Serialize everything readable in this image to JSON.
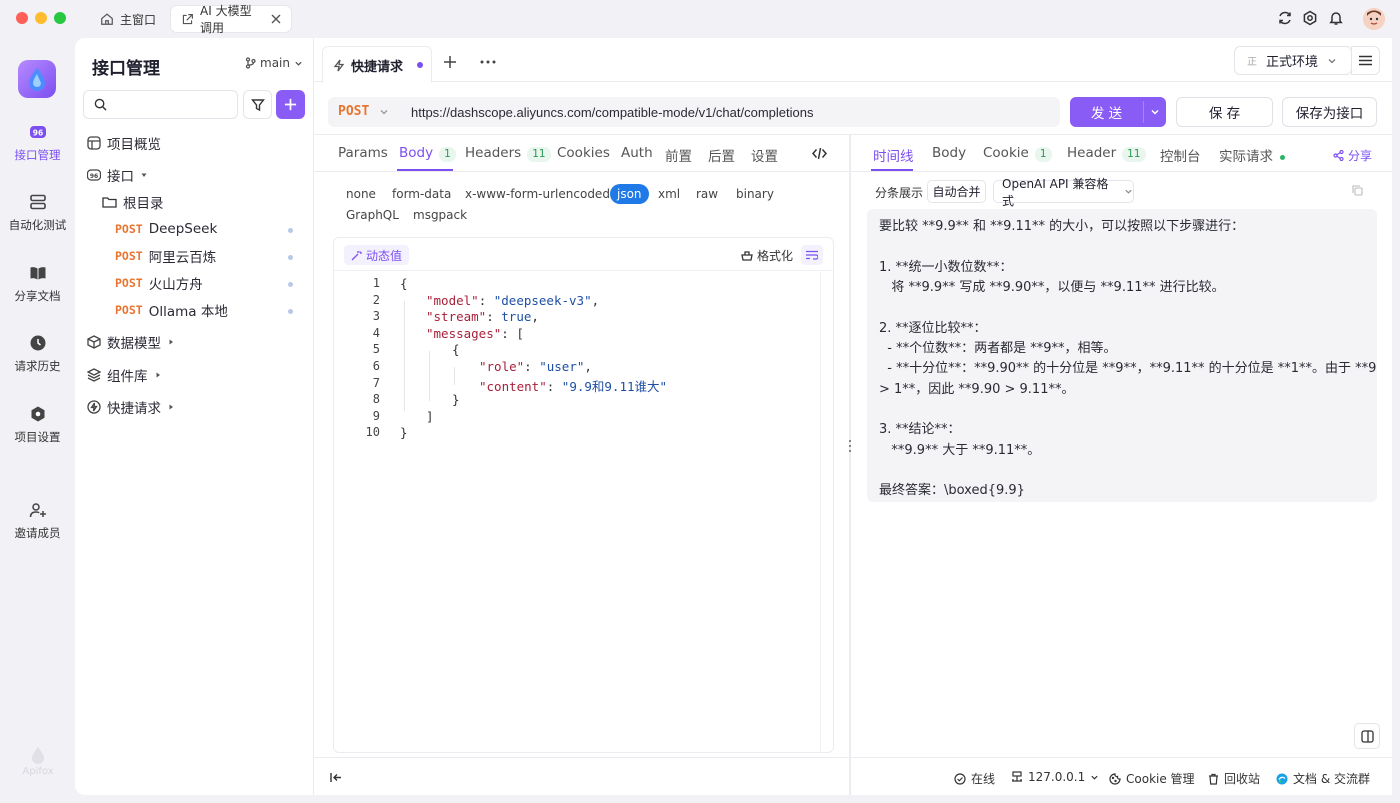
{
  "window_tabs": {
    "home": "主窗口",
    "active": "AI 大模型调用"
  },
  "rail": {
    "items": [
      {
        "label": "接口管理",
        "icon": "api-icon"
      },
      {
        "label": "自动化测试",
        "icon": "stack-icon"
      },
      {
        "label": "分享文档",
        "icon": "book-icon"
      },
      {
        "label": "请求历史",
        "icon": "clock-icon"
      },
      {
        "label": "项目设置",
        "icon": "gear-icon"
      },
      {
        "label": "邀请成员",
        "icon": "user-add-icon"
      }
    ],
    "footer_logo": "Apifox"
  },
  "sidebar": {
    "title": "接口管理",
    "branch": "main",
    "search_placeholder": "",
    "overview": "项目概览",
    "api_group": "接口",
    "root_folder": "根目录",
    "apis": [
      {
        "method": "POST",
        "name": "DeepSeek"
      },
      {
        "method": "POST",
        "name": "阿里云百炼"
      },
      {
        "method": "POST",
        "name": "火山方舟"
      },
      {
        "method": "POST",
        "name": "Ollama 本地"
      }
    ],
    "groups": [
      "数据模型",
      "组件库",
      "快捷请求"
    ]
  },
  "tabs": {
    "active": "快捷请求"
  },
  "environment": {
    "badge": "正",
    "label": "正式环境"
  },
  "request": {
    "method": "POST",
    "url": "https://dashscope.aliyuncs.com/compatible-mode/v1/chat/completions",
    "send": "发 送",
    "save": "保 存",
    "save_as": "保存为接口"
  },
  "req_tabs": [
    {
      "label": "Params"
    },
    {
      "label": "Body",
      "badge": "1"
    },
    {
      "label": "Headers",
      "badge": "11"
    },
    {
      "label": "Cookies"
    },
    {
      "label": "Auth"
    },
    {
      "label": "前置"
    },
    {
      "label": "后置"
    },
    {
      "label": "设置"
    }
  ],
  "body_types": [
    "none",
    "form-data",
    "x-www-form-urlencoded",
    "json",
    "xml",
    "raw",
    "binary",
    "GraphQL",
    "msgpack"
  ],
  "body_selected": "json",
  "editor": {
    "dynamic_value": "动态值",
    "format": "格式化",
    "line_numbers": [
      "1",
      "2",
      "3",
      "4",
      "5",
      "6",
      "7",
      "8",
      "9",
      "10"
    ]
  },
  "body_json": {
    "model": "deepseek-v3",
    "stream": "true",
    "role": "user",
    "content": "9.9和9.11谁大"
  },
  "resp_tabs": [
    {
      "label": "时间线"
    },
    {
      "label": "Body"
    },
    {
      "label": "Cookie",
      "badge": "1"
    },
    {
      "label": "Header",
      "badge": "11"
    },
    {
      "label": "控制台"
    },
    {
      "label": "实际请求"
    }
  ],
  "share": "分享",
  "resp_controls": {
    "split": "分条展示",
    "merge": "自动合并",
    "format": "OpenAI API 兼容格式"
  },
  "response_lines": [
    "要比较 **9.9** 和 **9.11** 的大小，可以按照以下步骤进行：",
    "",
    "1. **统一小数位数**：",
    "   将 **9.9** 写成 **9.90**，以便与 **9.11** 进行比较。",
    "",
    "2. **逐位比较**：",
    "  - **个位数**：两者都是 **9**，相等。",
    "  - **十分位**：**9.90** 的十分位是 **9**，**9.11** 的十分位是 **1**。由于 **9",
    "> 1**，因此 **9.90 > 9.11**。",
    "",
    "3. **结论**：",
    "   **9.9** 大于 **9.11**。",
    "",
    "最终答案：\\boxed{9.9}"
  ],
  "statusbar": {
    "online": "在线",
    "ip": "127.0.0.1",
    "cookie": "Cookie 管理",
    "trash": "回收站",
    "docs": "文档 & 交流群"
  },
  "colors": {
    "accent": "#7b4ff0",
    "post": "#e8742e",
    "selected_pill": "#1f7ae8",
    "badge_green": "#2b9a55"
  }
}
